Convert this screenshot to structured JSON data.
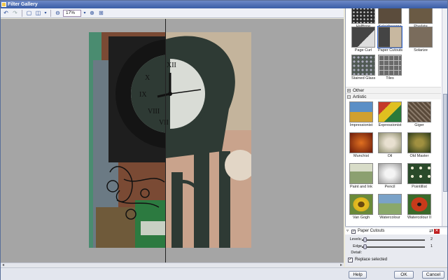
{
  "window": {
    "title": "Filter Gallery"
  },
  "toolbar": {
    "zoom_value": "17%"
  },
  "gallery": {
    "top_thumbs": [
      {
        "label": "Halftone",
        "color": "#2a2a2a"
      },
      {
        "label": "Kaleidoscope",
        "color": "#5b4c3c"
      },
      {
        "label": "Pixelate",
        "color": "#6a5a44"
      },
      {
        "label": "Page Curl",
        "color": "#3b3b3b"
      },
      {
        "label": "Paper Cutouts",
        "color": "#4a4a4a"
      },
      {
        "label": "Solarize",
        "color": "#7a6c5c"
      },
      {
        "label": "Stained Glass",
        "color": "#505a54"
      },
      {
        "label": "Tiles",
        "color": "#6a6a6a"
      }
    ],
    "categories": {
      "other": "Other",
      "artistic": "Artistic"
    },
    "artistic_thumbs": [
      {
        "label": "Impressionist",
        "color": "#5b8fc6"
      },
      {
        "label": "Expressionist",
        "color": "#c43a2a"
      },
      {
        "label": "Giger",
        "color": "#5a4a3a"
      },
      {
        "label": "Munchist",
        "color": "#c25a1a"
      },
      {
        "label": "Oil",
        "color": "#8c8c6c"
      },
      {
        "label": "Old Master",
        "color": "#3b4a2a"
      },
      {
        "label": "Paint and Ink",
        "color": "#8ca070"
      },
      {
        "label": "Pencil",
        "color": "#c8c8c8"
      },
      {
        "label": "Pointillist",
        "color": "#2a4a2a"
      },
      {
        "label": "Van Gogh",
        "color": "#d8b020"
      },
      {
        "label": "Watercolour",
        "color": "#7aa2c8"
      },
      {
        "label": "Watercolour II",
        "color": "#c83a1a"
      }
    ]
  },
  "effect": {
    "name": "Paper Cutouts",
    "levels_label": "Levels:",
    "levels_value": "2",
    "levels_fraction": 0.0,
    "edge_label": "Edge Detail:",
    "edge_value": "1",
    "edge_fraction": 0.0
  },
  "options": {
    "replace_selected_label": "Replace selected",
    "replace_selected_checked": true
  },
  "buttons": {
    "help": "Help",
    "ok": "OK",
    "cancel": "Cancel"
  }
}
